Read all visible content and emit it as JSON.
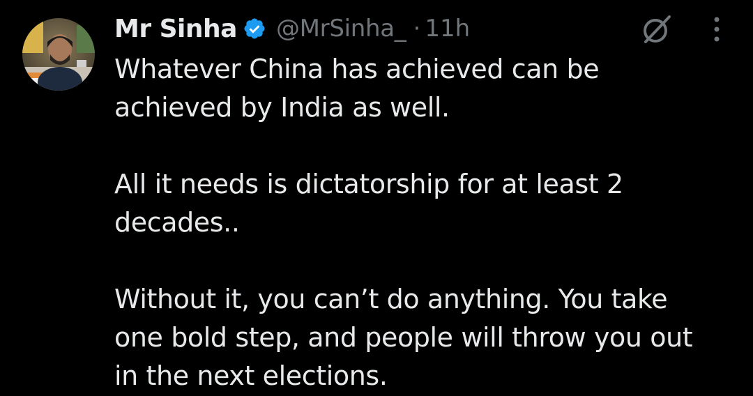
{
  "author": {
    "name": "Mr Sinha",
    "handle": "@MrSinha_",
    "separator": "·",
    "time": "11h",
    "verified": true
  },
  "icons": {
    "verified": "verified-badge-icon",
    "grok": "grok-icon",
    "more": "more-options-icon"
  },
  "colors": {
    "background": "#000000",
    "text": "#e7e9ea",
    "secondary": "#71767b",
    "verified": "#1d9bf0"
  },
  "tweet": {
    "lines": [
      "Whatever China has achieved can be",
      "achieved by India as well.",
      "",
      "All it needs is dictatorship for at least 2",
      "decades..",
      "",
      "Without it, you can’t do anything. You take",
      "one bold step, and people will throw you out",
      "in the next elections."
    ]
  }
}
